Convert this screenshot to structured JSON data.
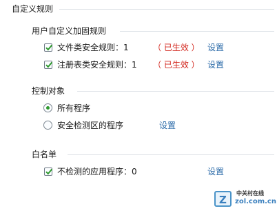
{
  "section_title": "自定义规则",
  "custom_rules": {
    "title": "用户自定义加固规则",
    "items": [
      {
        "label": "文件类安全规则：1",
        "status": "（ 已生效 ）",
        "action": "设置",
        "checked": true
      },
      {
        "label": "注册表类安全规则：1",
        "status": "（ 已生效 ）",
        "action": "设置",
        "checked": true
      }
    ]
  },
  "control_object": {
    "title": "控制对象",
    "options": [
      {
        "label": "所有程序",
        "selected": true
      },
      {
        "label": "安全检测区的程序",
        "selected": false,
        "action": "设置"
      }
    ]
  },
  "whitelist": {
    "title": "白名单",
    "item": {
      "label": "不检测的应用程序：0",
      "action": "设置",
      "checked": true
    }
  },
  "watermark": {
    "name": "中关村在线",
    "url": "zol.com.cn"
  },
  "colors": {
    "accent": "#2a6aa8",
    "status_red": "#d3261d",
    "check_green": "#2f9a2f"
  }
}
